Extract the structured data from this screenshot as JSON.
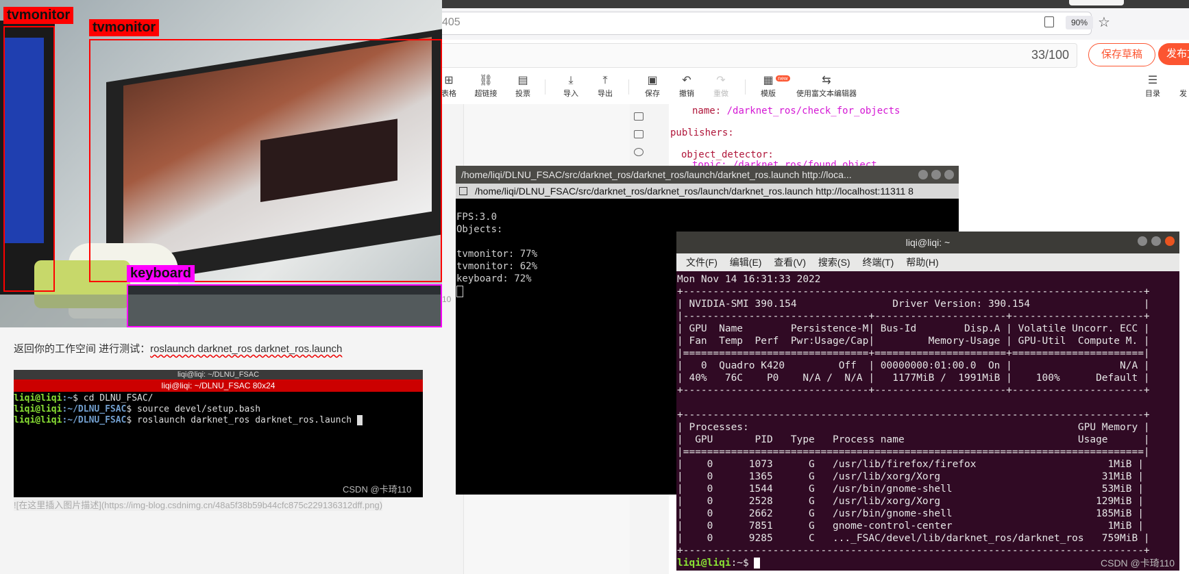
{
  "browser": {
    "url_fragment": "405",
    "zoom": "90%"
  },
  "editor": {
    "title_count": "33/100",
    "save_draft": "保存草稿",
    "publish": "发布文",
    "toolbar": [
      {
        "name": "table",
        "label": "表格",
        "icon": "⊞"
      },
      {
        "name": "hyperlink",
        "label": "超链接",
        "icon": "⛓"
      },
      {
        "name": "vote",
        "label": "投票",
        "icon": "▤"
      },
      {
        "name": "import",
        "label": "导入",
        "icon": "⤓"
      },
      {
        "name": "export",
        "label": "导出",
        "icon": "⤒"
      },
      {
        "name": "save",
        "label": "保存",
        "icon": "▣"
      },
      {
        "name": "undo",
        "label": "撤销",
        "icon": "↶"
      },
      {
        "name": "redo",
        "label": "重做",
        "icon": "↷"
      },
      {
        "name": "template",
        "label": "模版",
        "icon": "▦"
      },
      {
        "name": "rich-editor",
        "label": "使用富文本编辑器",
        "icon": "⇆"
      },
      {
        "name": "toc",
        "label": "目录",
        "icon": "☰"
      },
      {
        "name": "publish-short",
        "label": "发",
        "icon": ""
      }
    ],
    "new_badge": "new",
    "paragraph": "返回你的工作空间 进行测试：",
    "paragraph_cmd": "roslaunch darknet_ros darknet_ros.launch",
    "image_link": "![在这里插入图片描述](https://img-blog.csdnimg.cn/48a5f38b59b44cfc875c229136312dff.png)",
    "line_number_hint": "10"
  },
  "preview_yaml": {
    "line1_key": "name:",
    "line1_val": "/darknet_ros/check_for_objects",
    "line2_key": "publishers:",
    "line3_key": "object_detector:",
    "line4_partial": "topic: /darknet_ros/found_object"
  },
  "detection": {
    "labels": [
      "tvmonitor",
      "tvmonitor",
      "keyboard"
    ],
    "box_color_tv": "#ff0000",
    "box_color_kb": "#ff00ff"
  },
  "small_terminal": {
    "title": "liqi@liqi: ~/DLNU_FSAC",
    "tab": "liqi@liqi: ~/DLNU_FSAC 80x24",
    "lines": [
      {
        "user": "liqi@liqi",
        "path": ":~",
        "cmd": "$ cd DLNU_FSAC/"
      },
      {
        "user": "liqi@liqi",
        "path": ":~/DLNU_FSAC",
        "cmd": "$ source devel/setup.bash"
      },
      {
        "user": "liqi@liqi",
        "path": ":~/DLNU_FSAC",
        "cmd": "$ roslaunch darknet_ros darknet_ros.launch "
      }
    ],
    "watermark": "CSDN @卡琦110"
  },
  "darknet_terminal": {
    "title": "/home/liqi/DLNU_FSAC/src/darknet_ros/darknet_ros/launch/darknet_ros.launch http://loca...",
    "tab": "/home/liqi/DLNU_FSAC/src/darknet_ros/darknet_ros/launch/darknet_ros.launch http://localhost:11311 8",
    "lines": [
      "FPS:3.0",
      "Objects:",
      "",
      "tvmonitor: 77%",
      "tvmonitor: 62%",
      "keyboard: 72%"
    ]
  },
  "nvidia_terminal": {
    "title": "liqi@liqi: ~",
    "menu": [
      "文件(F)",
      "编辑(E)",
      "查看(V)",
      "搜索(S)",
      "终端(T)",
      "帮助(H)"
    ],
    "lines": [
      "Mon Nov 14 16:31:33 2022",
      "+-----------------------------------------------------------------------------+",
      "| NVIDIA-SMI 390.154                Driver Version: 390.154                   |",
      "|-------------------------------+----------------------+----------------------+",
      "| GPU  Name        Persistence-M| Bus-Id        Disp.A | Volatile Uncorr. ECC |",
      "| Fan  Temp  Perf  Pwr:Usage/Cap|         Memory-Usage | GPU-Util  Compute M. |",
      "|===============================+======================+======================|",
      "|   0  Quadro K420         Off  | 00000000:01:00.0  On |                  N/A |",
      "| 40%   76C    P0    N/A /  N/A |   1177MiB /  1991MiB |    100%      Default |",
      "+-------------------------------+----------------------+----------------------+",
      "",
      "+-----------------------------------------------------------------------------+",
      "| Processes:                                                       GPU Memory |",
      "|  GPU       PID   Type   Process name                             Usage      |",
      "|=============================================================================|",
      "|    0      1073      G   /usr/lib/firefox/firefox                      1MiB |",
      "|    0      1365      G   /usr/lib/xorg/Xorg                           31MiB |",
      "|    0      1544      G   /usr/bin/gnome-shell                         53MiB |",
      "|    0      2528      G   /usr/lib/xorg/Xorg                          129MiB |",
      "|    0      2662      G   /usr/bin/gnome-shell                        185MiB |",
      "|    0      7851      G   gnome-control-center                          1MiB |",
      "|    0      9285      C   ..._FSAC/devel/lib/darknet_ros/darknet_ros   759MiB |",
      "+-----------------------------------------------------------------------------+"
    ],
    "prompt_user": "liqi@liqi",
    "prompt_path": ":~$ ",
    "watermark": "CSDN @卡琦110"
  }
}
